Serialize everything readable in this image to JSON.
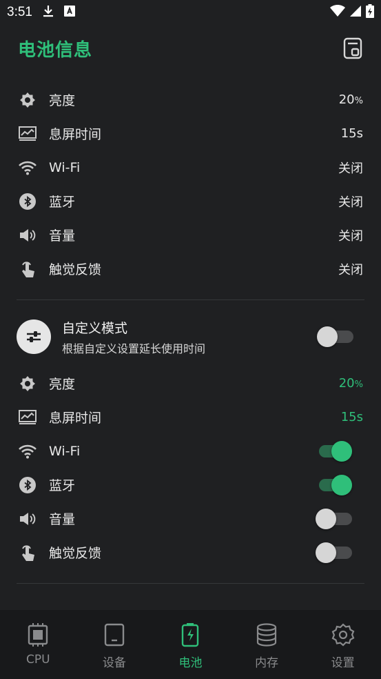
{
  "status_bar": {
    "time": "3:51"
  },
  "header": {
    "title": "电池信息"
  },
  "current_settings": [
    {
      "icon": "brightness-icon",
      "label": "亮度",
      "value": "20",
      "unit": "%"
    },
    {
      "icon": "screen-timeout-icon",
      "label": "息屏时间",
      "value": "15s"
    },
    {
      "icon": "wifi-icon",
      "label": "Wi-Fi",
      "value": "关闭"
    },
    {
      "icon": "bluetooth-icon",
      "label": "蓝牙",
      "value": "关闭"
    },
    {
      "icon": "volume-icon",
      "label": "音量",
      "value": "关闭"
    },
    {
      "icon": "touch-icon",
      "label": "触觉反馈",
      "value": "关闭"
    }
  ],
  "custom_mode": {
    "title": "自定义模式",
    "subtitle": "根据自定义设置延长使用时间",
    "enabled": false,
    "items": [
      {
        "icon": "brightness-icon",
        "label": "亮度",
        "value": "20",
        "unit": "%"
      },
      {
        "icon": "screen-timeout-icon",
        "label": "息屏时间",
        "value": "15s"
      },
      {
        "icon": "wifi-icon",
        "label": "Wi-Fi",
        "toggle": true
      },
      {
        "icon": "bluetooth-icon",
        "label": "蓝牙",
        "toggle": true
      },
      {
        "icon": "volume-icon",
        "label": "音量",
        "toggle": false
      },
      {
        "icon": "touch-icon",
        "label": "触觉反馈",
        "toggle": false
      }
    ]
  },
  "bottom_nav": [
    {
      "icon": "cpu-icon",
      "label": "CPU",
      "active": false
    },
    {
      "icon": "device-icon",
      "label": "设备",
      "active": false
    },
    {
      "icon": "battery-icon",
      "label": "电池",
      "active": true
    },
    {
      "icon": "memory-icon",
      "label": "内存",
      "active": false
    },
    {
      "icon": "settings-icon",
      "label": "设置",
      "active": false
    }
  ],
  "colors": {
    "accent": "#2fbf7a",
    "background": "#1f2022",
    "nav_background": "#18191b"
  }
}
